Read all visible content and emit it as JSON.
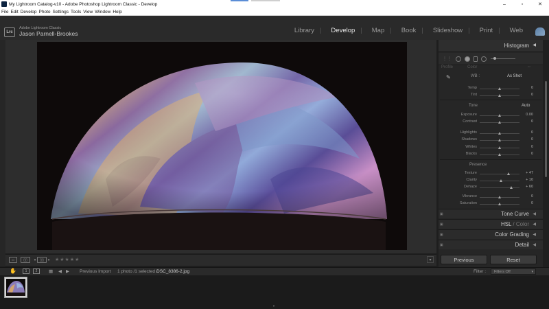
{
  "window": {
    "title": "My Lightroom Catalog-v10 - Adobe Photoshop Lightroom Classic - Develop",
    "controls": [
      "–",
      "▫",
      "✕"
    ]
  },
  "menu": [
    "File",
    "Edit",
    "Develop",
    "Photo",
    "Settings",
    "Tools",
    "View",
    "Window",
    "Help"
  ],
  "identity": {
    "badge": "Lrc",
    "product": "Adobe Lightroom Classic",
    "user": "Jason Parnell-Brookes"
  },
  "modules": [
    {
      "label": "Library",
      "active": false
    },
    {
      "label": "Develop",
      "active": true
    },
    {
      "label": "Map",
      "active": false
    },
    {
      "label": "Book",
      "active": false
    },
    {
      "label": "Slideshow",
      "active": false
    },
    {
      "label": "Print",
      "active": false
    },
    {
      "label": "Web",
      "active": false
    }
  ],
  "right_panel": {
    "histogram_label": "Histogram",
    "profile_label": "Profile",
    "profile_value": "Color",
    "wb_label": "WB :",
    "wb_value": "As Shot",
    "tone_label": "Tone",
    "auto_label": "Auto",
    "presence_label": "Presence",
    "sliders": [
      {
        "name": "Temp",
        "value": "0",
        "pos": 0.5
      },
      {
        "name": "Tint",
        "value": "0",
        "pos": 0.5
      },
      {
        "name": "Exposure",
        "value": "0.00",
        "pos": 0.5
      },
      {
        "name": "Contrast",
        "value": "0",
        "pos": 0.5
      },
      {
        "name": "Highlights",
        "value": "0",
        "pos": 0.5
      },
      {
        "name": "Shadows",
        "value": "0",
        "pos": 0.5
      },
      {
        "name": "Whites",
        "value": "0",
        "pos": 0.5
      },
      {
        "name": "Blacks",
        "value": "0",
        "pos": 0.5
      },
      {
        "name": "Texture",
        "value": "+ 47",
        "pos": 0.73
      },
      {
        "name": "Clarity",
        "value": "+ 10",
        "pos": 0.55
      },
      {
        "name": "Dehaze",
        "value": "+ 60",
        "pos": 0.8
      },
      {
        "name": "Vibrance",
        "value": "0",
        "pos": 0.5
      },
      {
        "name": "Saturation",
        "value": "0",
        "pos": 0.5
      }
    ],
    "collapsed_panels": [
      {
        "label": "Tone Curve"
      },
      {
        "label_main": "HSL",
        "label_dim": " / Color"
      },
      {
        "label": "Color Grading"
      },
      {
        "label": "Detail"
      }
    ],
    "previous_label": "Previous",
    "reset_label": "Reset"
  },
  "toolbar": {
    "stars": "★★★★★"
  },
  "filmstrip": {
    "screen1": "1",
    "screen2": "2",
    "source": "Previous Import",
    "count": "1 photo /1 selected /",
    "filename": "DSC_8386-2.jpg",
    "filter_label": "Filter :",
    "filter_value": "Filters Off"
  }
}
